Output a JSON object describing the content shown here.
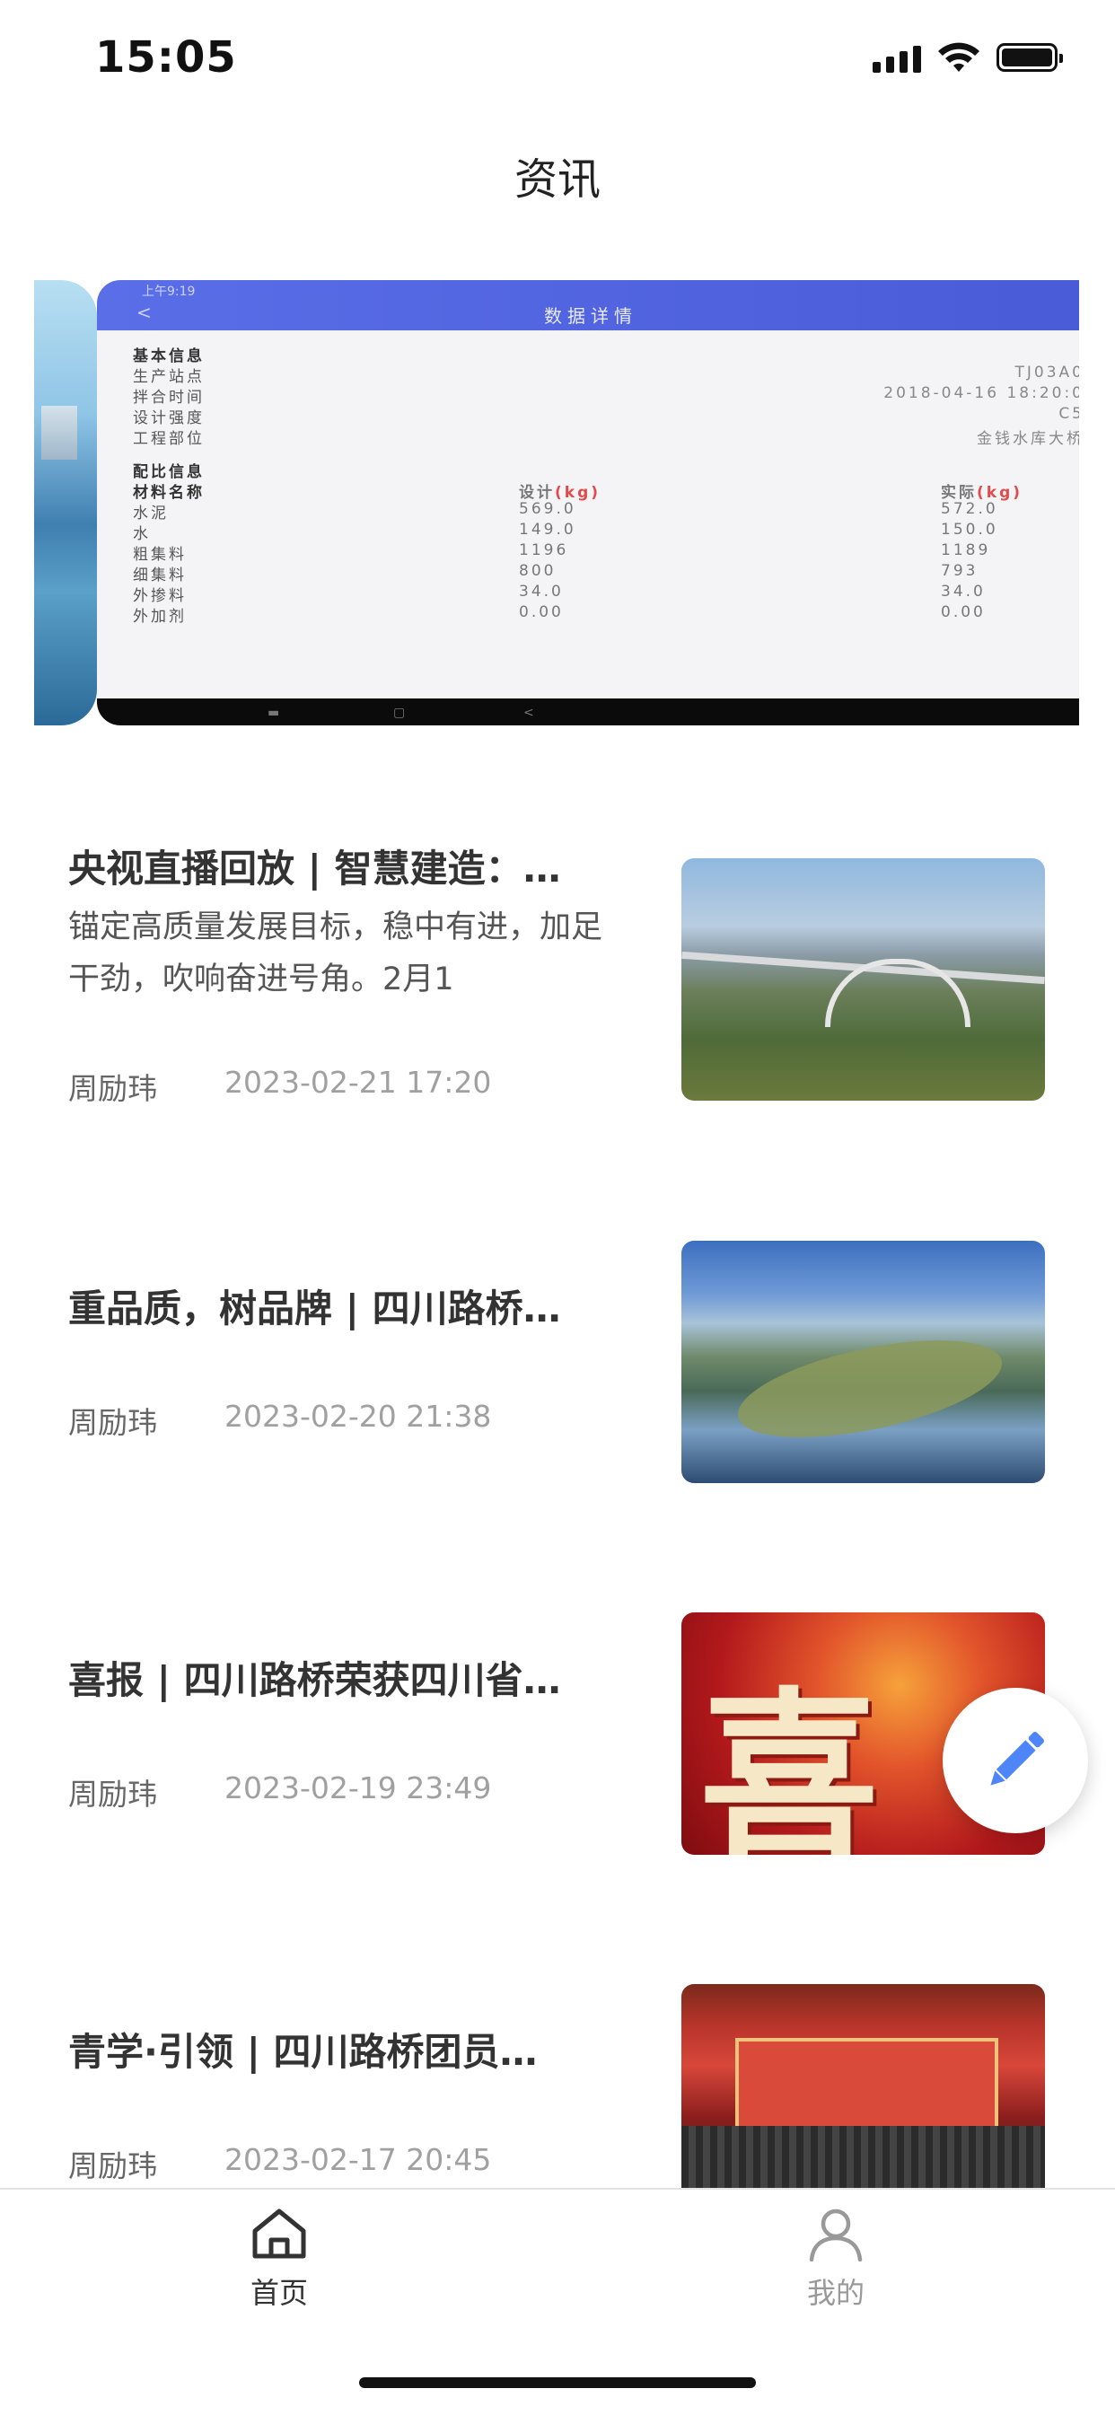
{
  "status_bar": {
    "time": "15:05"
  },
  "nav": {
    "title": "资讯"
  },
  "banner": {
    "status_time": "上午9:19",
    "back": "<",
    "title": "数据详情",
    "basic_header": "基本信息",
    "basic_rows": [
      {
        "label": "生产站点",
        "value": "TJ03A0"
      },
      {
        "label": "拌合时间",
        "value": "2018-04-16 18:20:0"
      },
      {
        "label": "设计强度",
        "value": "C5"
      },
      {
        "label": "工程部位",
        "value": "金钱水库大桥"
      }
    ],
    "mix_header": "配比信息",
    "mix_cols": {
      "name": "材料名称",
      "design": "设计",
      "actual": "实际",
      "unit": "(kg)"
    },
    "mix_rows": [
      {
        "name": "水泥",
        "design": "569.0",
        "actual": "572.0"
      },
      {
        "name": "水",
        "design": "149.0",
        "actual": "150.0"
      },
      {
        "name": "粗集料",
        "design": "1196",
        "actual": "1189"
      },
      {
        "name": "细集料",
        "design": "800",
        "actual": "793"
      },
      {
        "name": "外掺料",
        "design": "34.0",
        "actual": "34.0"
      },
      {
        "name": "外加剂",
        "design": "0.00",
        "actual": "0.00"
      }
    ],
    "nav_buttons": [
      "▬",
      "▢",
      "<"
    ]
  },
  "articles": [
    {
      "title": "央视直播回放 | 智慧建造：…",
      "summary": "锚定高质量发展目标，稳中有进，加足干劲，吹响奋进号角。2月1",
      "author": "周励玮",
      "time": "2023-02-21 17:20"
    },
    {
      "title": "重品质，树品牌 | 四川路桥…",
      "author": "周励玮",
      "time": "2023-02-20 21:38"
    },
    {
      "title": "喜报 | 四川路桥荣获四川省…",
      "author": "周励玮",
      "time": "2023-02-19 23:49"
    },
    {
      "title": "青学·引领 | 四川路桥团员…",
      "author": "周励玮",
      "time": "2023-02-17 20:45"
    }
  ],
  "thumb3_text": "喜",
  "tabs": {
    "home": "首页",
    "me": "我的"
  },
  "colors": {
    "accent": "#4f86f7",
    "header_blue": "#4a5bd8"
  }
}
